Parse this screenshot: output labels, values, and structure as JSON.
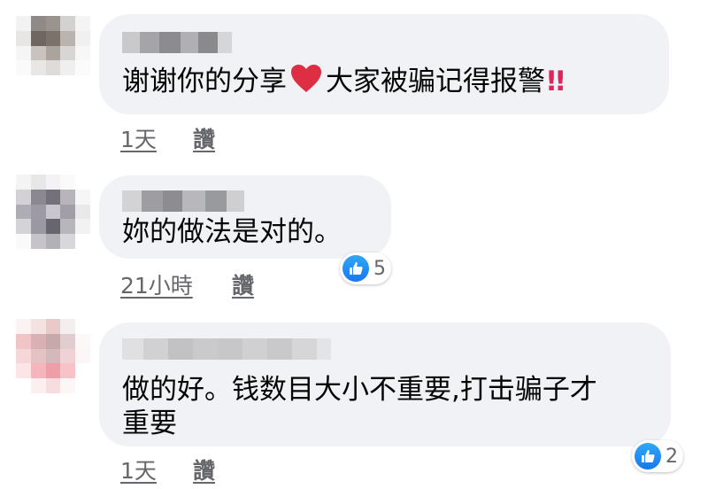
{
  "comments": [
    {
      "text": "谢谢你的分享",
      "text_after_heart": "大家被骗记得报警",
      "emphasis": "!!",
      "time": "1天",
      "like_label": "讚"
    },
    {
      "text": "妳的做法是对的。",
      "time": "21小時",
      "like_label": "讚",
      "reaction_count": "5"
    },
    {
      "text_line1": "做的好。钱数目大小不重要,打击骗子才",
      "text_line2": "重要",
      "time": "1天",
      "like_label": "讚",
      "reaction_count": "2"
    }
  ],
  "icons": {
    "heart": "red-heart-icon",
    "like": "like-thumb-icon"
  },
  "colors": {
    "bubble": "#f0f2f5",
    "meta_text": "#65676b",
    "like_blue": "#1877f2",
    "heart_red": "#e0245e"
  }
}
